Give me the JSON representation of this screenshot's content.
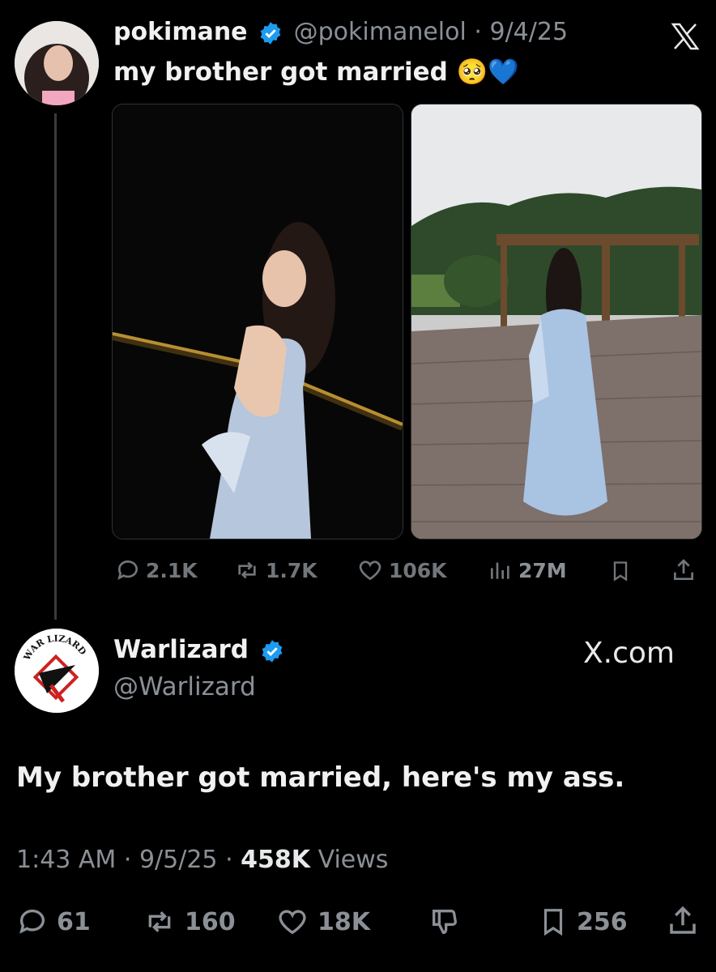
{
  "quoted_tweet": {
    "display_name": "pokimane",
    "handle": "@pokimanelol",
    "separator": "·",
    "date": "9/4/25",
    "text": "my brother got married 🥺💙",
    "stats": {
      "replies": "2.1K",
      "reposts": "1.7K",
      "likes": "106K",
      "views": "27M"
    }
  },
  "reply_tweet": {
    "display_name": "Warlizard",
    "handle": "@Warlizard",
    "site_label": "X.com",
    "avatar_text": "WAR LIZARD",
    "text": "My brother got married, here's my ass.",
    "time": "1:43 AM",
    "separator1": "·",
    "date": "9/5/25",
    "separator2": "·",
    "views_count": "458K",
    "views_label": "Views",
    "stats": {
      "replies": "61",
      "reposts": "160",
      "likes": "18K",
      "bookmarks": "256"
    }
  },
  "colors": {
    "background": "#000000",
    "verified_blue": "#1d9bf0",
    "muted": "#71767b"
  },
  "icons": [
    "x-logo-icon",
    "verified-icon",
    "reply-icon",
    "repost-icon",
    "like-icon",
    "views-icon",
    "bookmark-icon",
    "share-icon",
    "dislike-icon"
  ]
}
